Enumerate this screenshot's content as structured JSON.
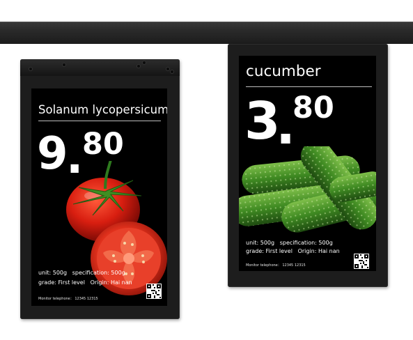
{
  "colors": {
    "screen_bg": "#000000",
    "text": "#ffffff",
    "rail": "#2a2a2a",
    "bezel": "#1d1d1d"
  },
  "tags": [
    {
      "product_name": "Solanum lycopersicum",
      "price_integer": "9",
      "price_dot": ".",
      "price_decimal": "80",
      "unit": "unit: 500g",
      "specification": "specification: 500g",
      "grade": "grade: First level",
      "origin": "Origin: Hai nan",
      "monitor_telephone": "Monitor telephone： 12345  12315",
      "image": "tomato-photo",
      "qr": "qr-code-icon"
    },
    {
      "product_name": "cucumber",
      "price_integer": "3",
      "price_dot": ".",
      "price_decimal": "80",
      "unit": "unit: 500g",
      "specification": "specification: 500g",
      "grade": "grade: First level",
      "origin": "Origin: Hai nan",
      "monitor_telephone": "Monitor telephone： 12345  12315",
      "image": "cucumber-photo",
      "qr": "qr-code-icon"
    }
  ]
}
